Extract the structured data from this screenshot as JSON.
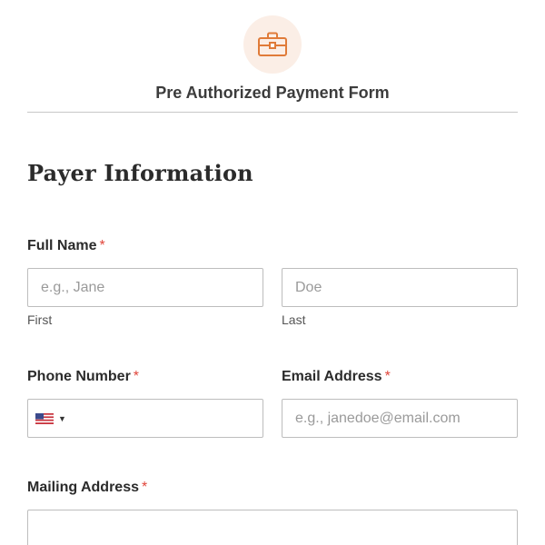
{
  "form": {
    "title": "Pre Authorized Payment Form",
    "header_icon": "briefcase-icon",
    "accent_color": "#e07b39"
  },
  "section": {
    "title": "Payer Information"
  },
  "fields": {
    "full_name": {
      "label": "Full Name",
      "required_mark": "*",
      "first": {
        "placeholder": "e.g., Jane",
        "sublabel": "First"
      },
      "last": {
        "placeholder": "Doe",
        "sublabel": "Last"
      }
    },
    "phone": {
      "label": "Phone Number",
      "required_mark": "*",
      "country_flag": "us-flag-icon",
      "value": ""
    },
    "email": {
      "label": "Email Address",
      "required_mark": "*",
      "placeholder": "e.g., janedoe@email.com"
    },
    "mailing_address": {
      "label": "Mailing Address",
      "required_mark": "*",
      "value": ""
    }
  }
}
